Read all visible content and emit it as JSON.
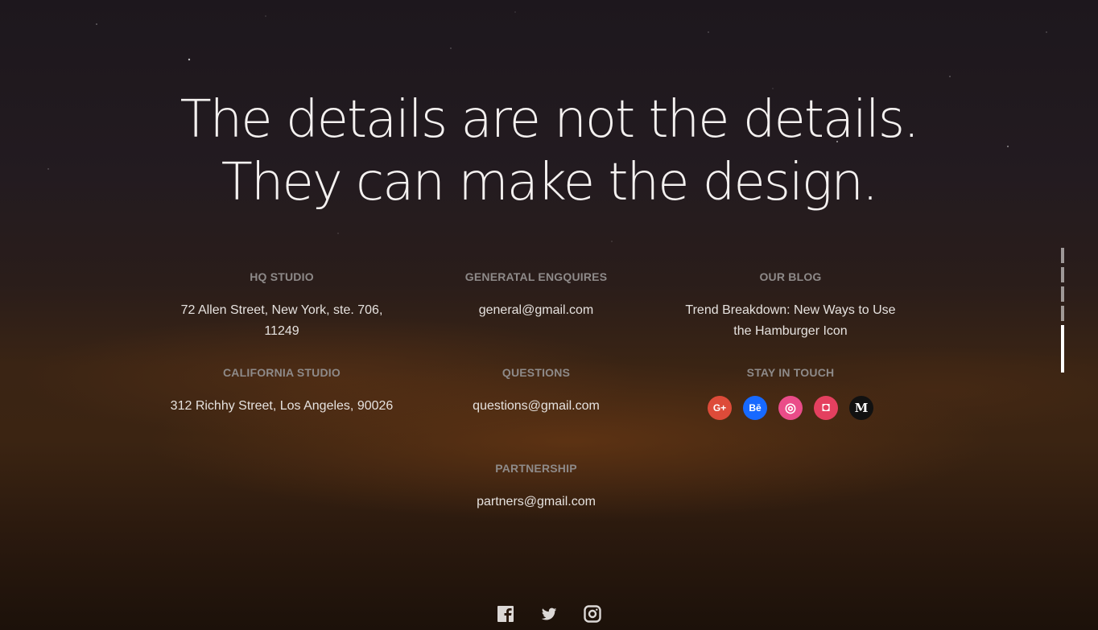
{
  "headline": {
    "line1": "The details are not the details.",
    "line2": "They can make the design."
  },
  "contacts": {
    "hq": {
      "label": "HQ STUDIO",
      "value": "72 Allen Street, New York, ste. 706, 11249"
    },
    "california": {
      "label": "CALIFORNIA STUDIO",
      "value": "312 Richhy Street, Los Angeles, 90026"
    },
    "general": {
      "label": "GENERATAL ENGQUIRES",
      "value": "general@gmail.com"
    },
    "questions": {
      "label": "QUESTIONS",
      "value": "questions@gmail.com"
    },
    "partnership": {
      "label": "PARTNERSHIP",
      "value": "partners@gmail.com"
    },
    "blog": {
      "label": "OUR BLOG",
      "value": "Trend Breakdown: New Ways to Use the Hamburger Icon"
    },
    "stay": {
      "label": "STAY IN TOUCH"
    }
  },
  "social": [
    {
      "name": "google-plus-icon",
      "glyph": "G+",
      "color": "#dd4b39"
    },
    {
      "name": "behance-icon",
      "glyph": "Bē",
      "color": "#1769ff"
    },
    {
      "name": "dribbble-icon",
      "glyph": "◎",
      "color": "#ea4c89"
    },
    {
      "name": "instagram-icon",
      "glyph": "◘",
      "color": "#e4405f"
    },
    {
      "name": "medium-icon",
      "glyph": "M",
      "color": "#111111"
    }
  ],
  "footer_icons": [
    "facebook-icon",
    "twitter-icon",
    "instagram-icon"
  ],
  "pager": {
    "count": 5,
    "active_index": 4
  }
}
